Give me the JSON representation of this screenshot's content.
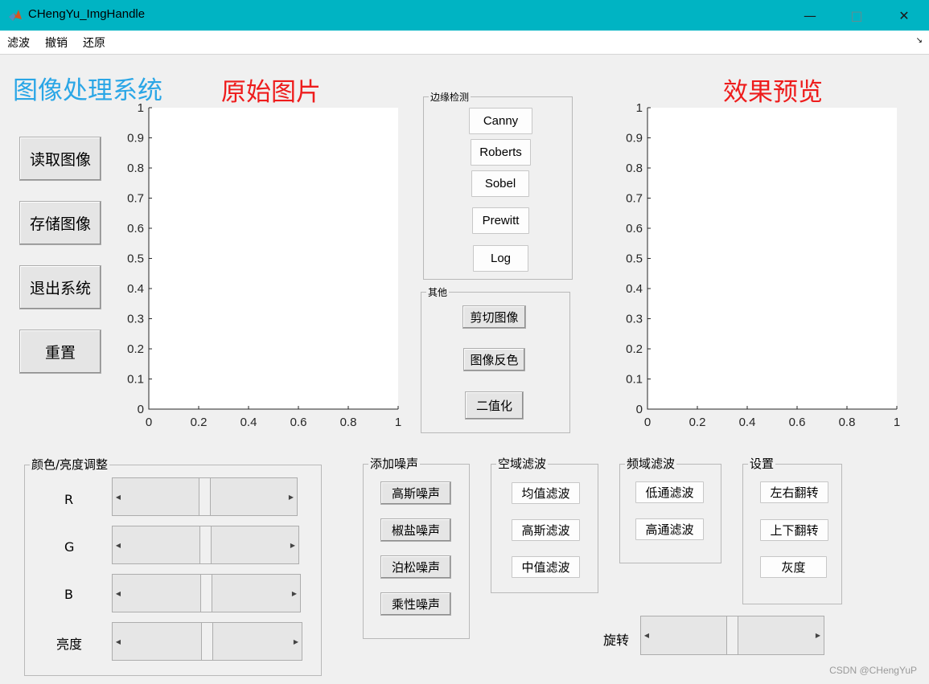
{
  "window": {
    "title": "CHengYu_ImgHandle",
    "controls": {
      "minimize": "—",
      "maximize": "□",
      "close": "✕"
    }
  },
  "menu": {
    "items": [
      "滤波",
      "撤销",
      "还原"
    ],
    "corner_icon": "↘"
  },
  "headings": {
    "system": "图像处理系统",
    "original": "原始图片",
    "preview": "效果预览"
  },
  "colors": {
    "system_heading": "#2aa6e6",
    "image_headings": "#ee1c1c",
    "titlebar": "#00b4c3"
  },
  "left_buttons": [
    "读取图像",
    "存储图像",
    "退出系统",
    "重置"
  ],
  "axes": {
    "y_ticks": [
      "1",
      "0.9",
      "0.8",
      "0.7",
      "0.6",
      "0.5",
      "0.4",
      "0.3",
      "0.2",
      "0.1",
      "0"
    ],
    "x_ticks": [
      "0",
      "0.2",
      "0.4",
      "0.6",
      "0.8",
      "1"
    ]
  },
  "edge_panel": {
    "title": "边缘检测",
    "buttons": [
      "Canny",
      "Roberts",
      "Sobel",
      "Prewitt",
      "Log"
    ]
  },
  "other_panel": {
    "title": "其他",
    "buttons": [
      "剪切图像",
      "图像反色",
      "二值化"
    ]
  },
  "color_panel": {
    "title": "颜色/亮度调整",
    "sliders": [
      {
        "label": "R",
        "value": 0.5
      },
      {
        "label": "G",
        "value": 0.5
      },
      {
        "label": "B",
        "value": 0.5
      },
      {
        "label": "亮度",
        "value": 0.5
      }
    ]
  },
  "noise_panel": {
    "title": "添加噪声",
    "buttons": [
      "高斯噪声",
      "椒盐噪声",
      "泊松噪声",
      "乘性噪声"
    ]
  },
  "spatial_panel": {
    "title": "空域滤波",
    "buttons": [
      "均值滤波",
      "高斯滤波",
      "中值滤波"
    ]
  },
  "freq_panel": {
    "title": "频域滤波",
    "buttons": [
      "低通滤波",
      "高通滤波"
    ]
  },
  "settings_panel": {
    "title": "设置",
    "buttons": [
      "左右翻转",
      "上下翻转",
      "灰度"
    ]
  },
  "rotate": {
    "label": "旋转",
    "value": 0.5
  },
  "watermark": "CSDN @CHengYuP"
}
